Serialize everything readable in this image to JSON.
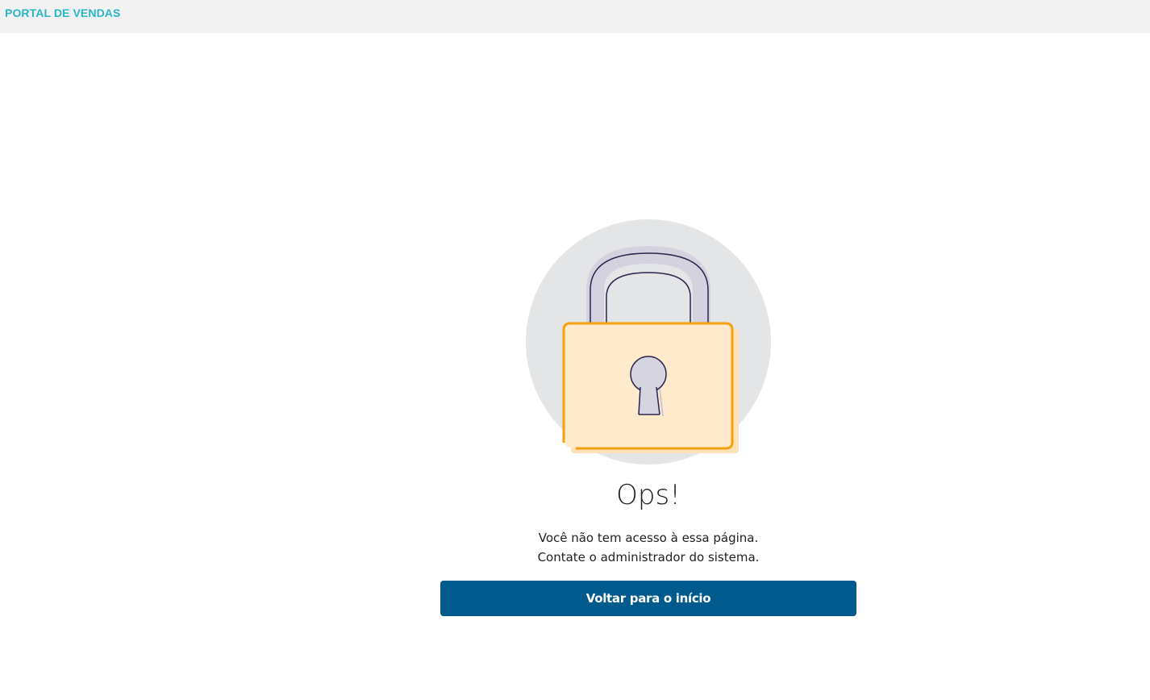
{
  "header": {
    "brand": "PORTAL DE VENDAS"
  },
  "main": {
    "illustration_icon": "padlock-icon",
    "title": "Ops!",
    "message_line1": "Você não tem acesso à essa página.",
    "message_line2": "Contate o administrador do sistema.",
    "back_button_label": "Voltar para o início"
  },
  "colors": {
    "brand_text": "#29b6c8",
    "header_bg": "#f2f2f2",
    "button_bg": "#005a8e",
    "lock_body_fill": "#ffeacc",
    "lock_outline": "#f5a00f",
    "circle_bg": "#e3e5e6"
  }
}
